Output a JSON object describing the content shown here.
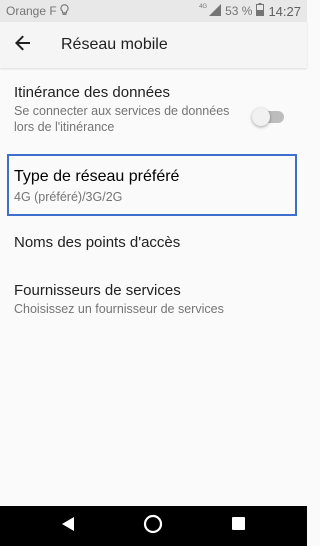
{
  "status_bar": {
    "carrier": "Orange F",
    "network_type": "4G",
    "battery": "53 %",
    "time": "14:27"
  },
  "app_bar": {
    "title": "Réseau mobile"
  },
  "settings": {
    "roaming": {
      "title": "Itinérance des données",
      "summary": "Se connecter aux services de données lors de l'itinérance",
      "enabled": false
    },
    "preferred_network": {
      "title": "Type de réseau préféré",
      "summary": "4G (préféré)/3G/2G"
    },
    "apn": {
      "title": "Noms des points d'accès"
    },
    "providers": {
      "title": "Fournisseurs de services",
      "summary": "Choisissez un fournisseur de services"
    }
  },
  "icons": {
    "status": [
      "notification-bulb-icon",
      "signal-icon",
      "battery-icon"
    ],
    "navigation": [
      "back-arrow-icon",
      "nav-back-icon",
      "nav-home-icon",
      "nav-recents-icon"
    ]
  },
  "colors": {
    "focus_outline": "#3f6fce",
    "toggle_track_off": "#bdbdbd",
    "nav_bar": "#000000"
  }
}
